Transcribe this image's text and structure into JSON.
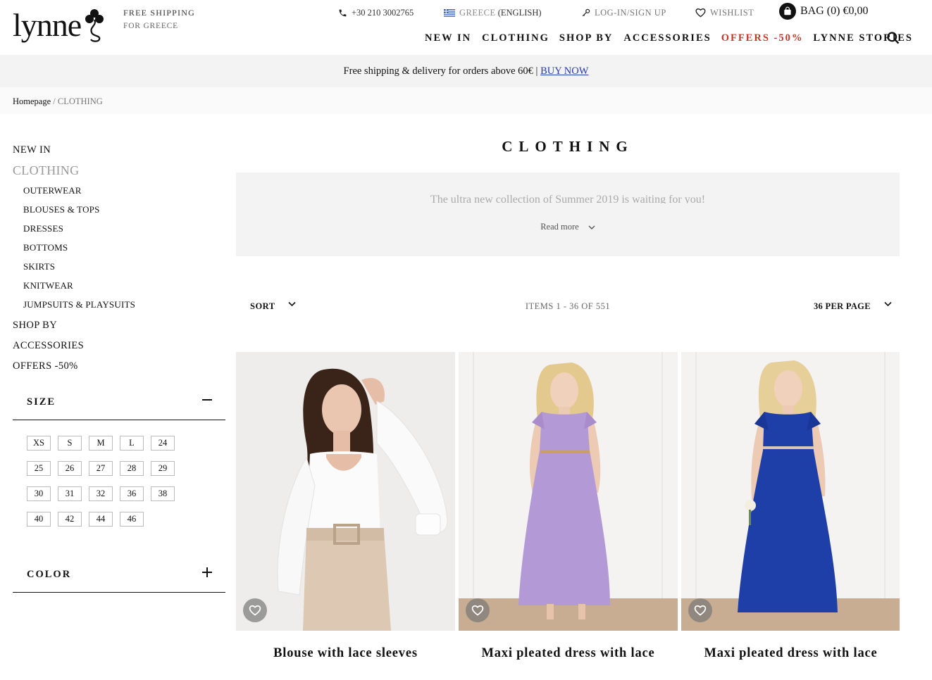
{
  "header": {
    "logo_text": "lynne",
    "promo_line1": "FREE SHIPPING",
    "promo_line2": "FOR GREECE",
    "phone": "+30 210 3002765",
    "lang_country": "GREECE",
    "lang_language": "(ENGLISH)",
    "login": "LOG-IN/SIGN UP",
    "wishlist": "WISHLIST",
    "bag": "BAG (0) €0,00"
  },
  "nav": [
    {
      "label": "NEW IN",
      "offer": false
    },
    {
      "label": "CLOTHING",
      "offer": false
    },
    {
      "label": "SHOP BY",
      "offer": false
    },
    {
      "label": "ACCESSORIES",
      "offer": false
    },
    {
      "label": "OFFERS -50%",
      "offer": true
    },
    {
      "label": "LYNNE STORIES",
      "offer": false
    }
  ],
  "banner": {
    "text": "Free shipping & delivery for orders above 60€ | ",
    "link": "BUY NOW"
  },
  "breadcrumb": {
    "home": "Homepage",
    "separator": " / ",
    "current": "CLOTHING"
  },
  "sidebar": {
    "top1": "NEW IN",
    "active": "CLOTHING",
    "subs": [
      "OUTERWEAR",
      "BLOUSES & TOPS",
      "DRESSES",
      "BOTTOMS",
      "SKIRTS",
      "KNITWEAR",
      "JUMPSUITS & PLAYSUITS"
    ],
    "after": [
      "SHOP BY",
      "ACCESSORIES",
      "OFFERS -50%"
    ]
  },
  "filters": {
    "size_title": "SIZE",
    "size_state": "expanded",
    "sizes": [
      "XS",
      "S",
      "M",
      "L",
      "24",
      "25",
      "26",
      "27",
      "28",
      "29",
      "30",
      "31",
      "32",
      "36",
      "38",
      "40",
      "42",
      "44",
      "46"
    ],
    "color_title": "COLOR",
    "color_state": "collapsed"
  },
  "main": {
    "title": "CLOTHING",
    "description": "The ultra new collection of Summer 2019 is waiting for you!",
    "read_more": "Read more",
    "sort": "SORT",
    "count": "ITEMS 1 - 36 OF 551",
    "per_page": "36 PER PAGE"
  },
  "products": [
    {
      "name": "Blouse with lace sleeves",
      "variant": "white-blouse"
    },
    {
      "name": "Maxi pleated dress with lace",
      "variant": "lilac-dress"
    },
    {
      "name": "Maxi pleated dress with lace",
      "variant": "blue-dress"
    }
  ],
  "colors": {
    "offer": "#c8352b",
    "link": "#2538b5",
    "lilac": "#b39ad6",
    "royal_blue": "#1f3fa8"
  }
}
